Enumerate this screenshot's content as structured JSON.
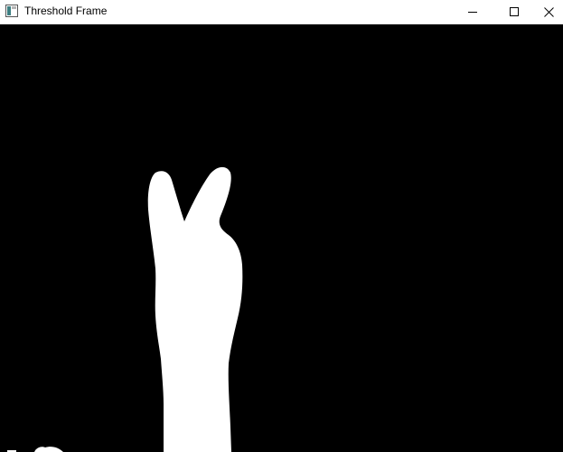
{
  "window": {
    "title": "Threshold Frame",
    "controls": {
      "minimize_icon": "minimize-icon",
      "maximize_icon": "maximize-icon",
      "close_icon": "close-icon"
    }
  },
  "frame": {
    "background_color": "#000000",
    "foreground_color": "#ffffff"
  }
}
